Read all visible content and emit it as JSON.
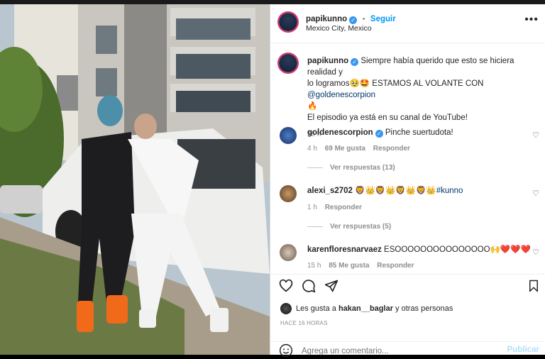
{
  "post": {
    "username": "papikunno",
    "follow_label": "Seguir",
    "location": "Mexico City, Mexico",
    "caption_line1": "Siempre había querido que esto se hiciera realidad y",
    "caption_line2": "lo logramos🥹🤩 ESTAMOS AL VOLANTE CON",
    "caption_mention": "@goldenescorpion",
    "caption_line3": "🔥",
    "caption_line4": "El episodio ya está en su canal de YouTube!",
    "caption_time": "16 h"
  },
  "comments": [
    {
      "username": "goldenescorpion",
      "text": "Pinche suertudota!",
      "time": "4 h",
      "likes": "69 Me gusta",
      "reply": "Responder",
      "replies": "Ver respuestas (13)"
    },
    {
      "username": "alexi_s2702",
      "text": "🦁👑🦁👑🦁👑🦁👑",
      "hashtag": "#kunno",
      "time": "1 h",
      "reply": "Responder",
      "replies": "Ver respuestas (5)"
    },
    {
      "username": "karenfloresnarvaez",
      "text": "ESOOOOOOOOOOOOOOO🙌❤️❤️❤️",
      "time": "15 h",
      "likes": "85 Me gusta",
      "reply": "Responder"
    }
  ],
  "likes_prefix": "Les gusta a",
  "likes_user": "hakan__baglar",
  "likes_suffix": "y otras personas",
  "post_time": "HACE 16 HORAS",
  "comment_placeholder": "Agrega un comentario...",
  "publish_label": "Publicar",
  "colors": {
    "accent_blue": "#0095f6",
    "story_ring": "#e1306c",
    "verified": "#3897f0"
  }
}
